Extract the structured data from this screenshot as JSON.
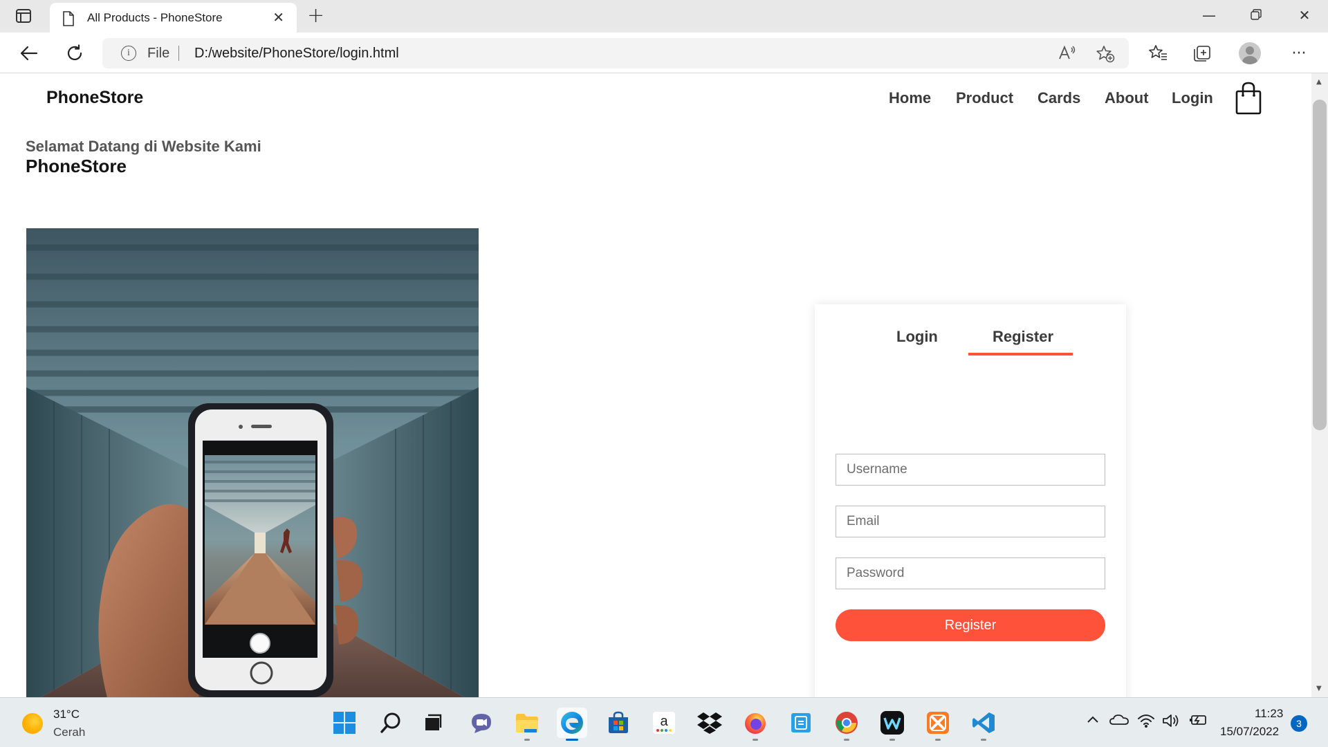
{
  "browser": {
    "tab_title": "All Products - PhoneStore",
    "address_scheme": "File",
    "address_url": "D:/website/PhoneStore/login.html"
  },
  "site": {
    "logo": "PhoneStore",
    "nav": [
      "Home",
      "Product",
      "Cards",
      "About",
      "Login"
    ],
    "welcome_line": "Selamat Datang di Website Kami",
    "welcome_brand": "PhoneStore"
  },
  "form": {
    "tabs": [
      "Login",
      "Register"
    ],
    "active_tab": "Register",
    "username_placeholder": "Username",
    "email_placeholder": "Email",
    "password_placeholder": "Password",
    "submit_label": "Register"
  },
  "taskbar": {
    "temperature": "31°C",
    "condition": "Cerah",
    "time": "11:23",
    "date": "15/07/2022",
    "notification_count": "3",
    "apps": [
      "start",
      "search",
      "task-view",
      "teams-chat",
      "file-explorer",
      "edge",
      "microsoft-store",
      "amazon",
      "dropbox",
      "firefox",
      "apple-devices",
      "chrome",
      "webex",
      "xampp",
      "vscode"
    ]
  },
  "colors": {
    "accent": "#ff523b",
    "text_dark": "#141414",
    "nav_text": "#3b3b3b"
  }
}
